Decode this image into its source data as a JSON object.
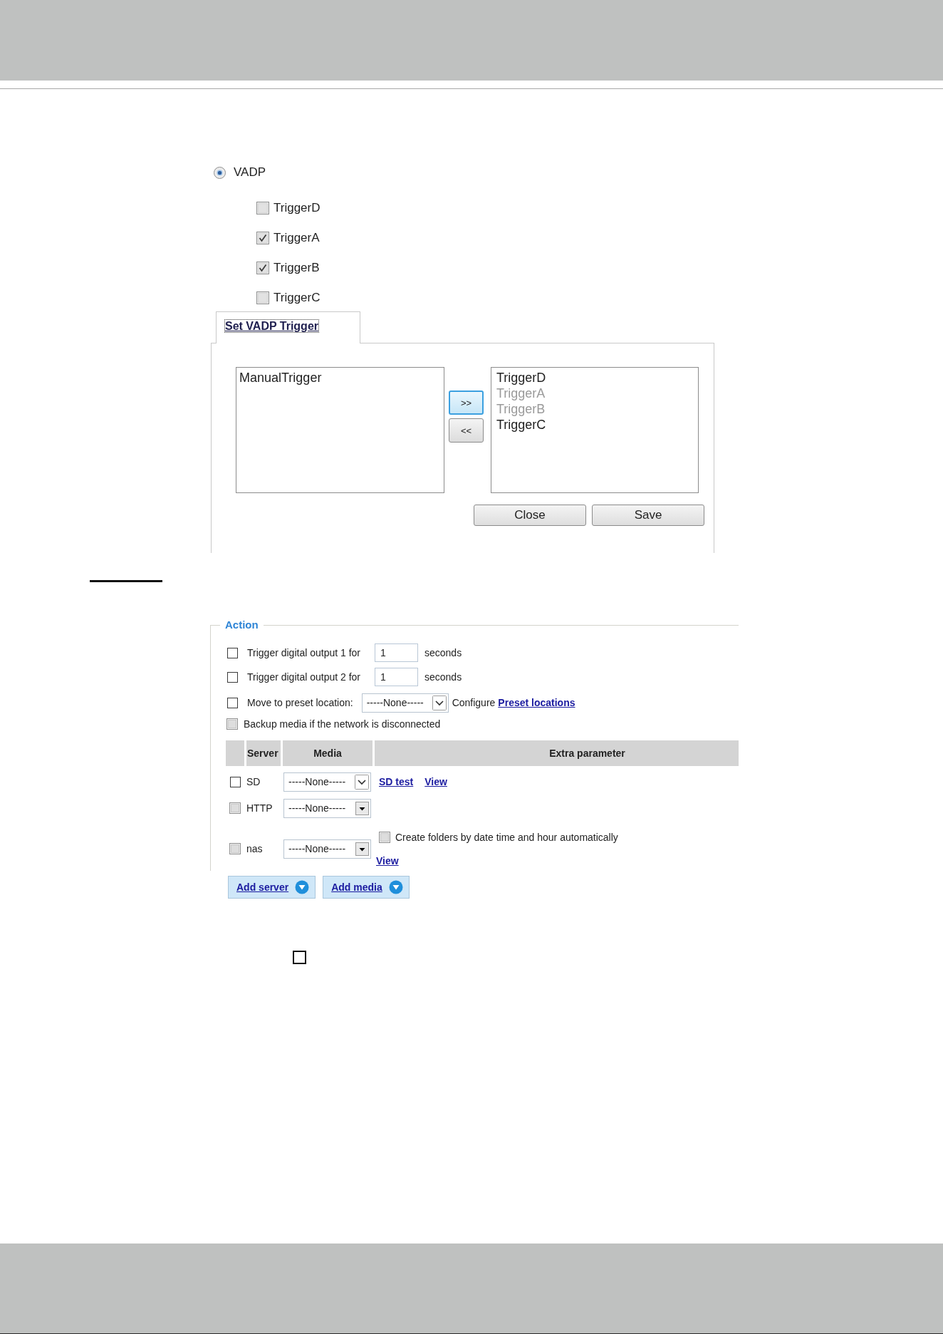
{
  "vadp_option": {
    "label": "VADP",
    "selected": true
  },
  "triggers": [
    {
      "label": "TriggerD",
      "checked": false
    },
    {
      "label": "TriggerA",
      "checked": true
    },
    {
      "label": "TriggerB",
      "checked": true
    },
    {
      "label": "TriggerC",
      "checked": false
    }
  ],
  "trigger_dialog": {
    "tab": {
      "label": "Set VADP Trigger",
      "selected": true
    },
    "available_list": [
      {
        "label": "ManualTrigger",
        "disabled": false
      }
    ],
    "move_buttons": [
      {
        "label": ">>",
        "focused": true
      },
      {
        "label": "<<",
        "focused": false
      }
    ],
    "selected_list": [
      {
        "label": "TriggerD",
        "disabled": false
      },
      {
        "label": "TriggerA",
        "disabled": true
      },
      {
        "label": "TriggerB",
        "disabled": true
      },
      {
        "label": "TriggerC",
        "disabled": false
      }
    ],
    "buttons": [
      "Close",
      "Save"
    ]
  },
  "action": {
    "legend": "Action",
    "options": [
      {
        "kind": "duration",
        "checked": false,
        "label": "Trigger digital output 1 for",
        "value": "1",
        "unit": "seconds"
      },
      {
        "kind": "duration",
        "checked": false,
        "label": "Trigger digital output 2 for",
        "value": "1",
        "unit": "seconds"
      },
      {
        "kind": "preset",
        "checked": false,
        "label": "Move to preset location:",
        "select": "-----None-----",
        "note": "Configure",
        "link": "Preset locations"
      },
      {
        "kind": "backup",
        "checked": false,
        "label": "Backup media if the network is disconnected"
      }
    ],
    "table": {
      "columns": [
        "Server",
        "Media",
        "Extra parameter"
      ],
      "rows": [
        {
          "kind": "plain",
          "checked": false,
          "server": "SD",
          "media": "-----None-----",
          "links": [
            "SD test",
            "View"
          ]
        },
        {
          "kind": "classic",
          "checked": false,
          "server": "HTTP",
          "media": "-----None-----"
        },
        {
          "kind": "classic",
          "checked": false,
          "server": "nas",
          "media": "-----None-----",
          "option": {
            "checked": false,
            "label": "Create folders by date time and hour automatically"
          },
          "links": [
            "View"
          ]
        }
      ]
    },
    "buttons": [
      "Add server",
      "Add media"
    ]
  },
  "extra_checkbox": {
    "checked": false
  }
}
